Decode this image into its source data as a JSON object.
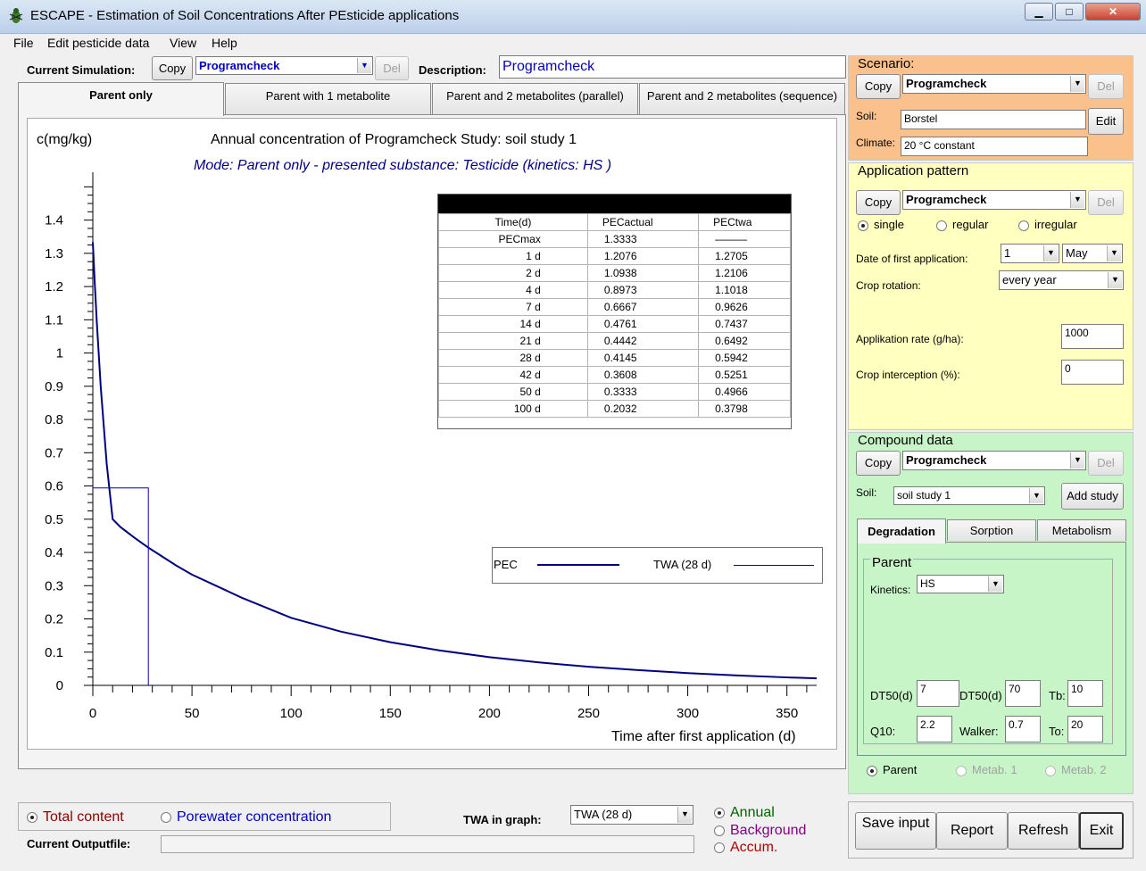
{
  "window": {
    "title": "ESCAPE - Estimation of Soil Concentrations After PEsticide applications",
    "app_icon": "bug-icon"
  },
  "menu": [
    "File",
    "Edit pesticide data",
    "View",
    "Help"
  ],
  "simulation": {
    "label": "Current  Simulation:",
    "copy": "Copy",
    "value": "Programcheck",
    "del": "Del",
    "desc_label": "Description:",
    "desc_value": "Programcheck"
  },
  "tabs": [
    "Parent only",
    "Parent with 1 metabolite",
    "Parent and 2 metabolites (parallel)",
    "Parent and 2 metabolites (sequence)"
  ],
  "chart_data": {
    "type": "line",
    "title": "Annual concentration of Programcheck Study: soil study 1",
    "subtitle": "Mode: Parent only  - presented substance: Testicide (kinetics: HS )",
    "ylabel": "c(mg/kg)",
    "xlabel": "Time after first application (d)",
    "xlim": [
      0,
      365
    ],
    "ylim": [
      0,
      1.45
    ],
    "xticks": [
      "0",
      "50",
      "100",
      "150",
      "200",
      "250",
      "300",
      "350"
    ],
    "yticks": [
      "0",
      "0.1",
      "0.2",
      "0.3",
      "0.4",
      "0.5",
      "0.6",
      "0.7",
      "0.8",
      "0.9",
      "1",
      "1.1",
      "1.2",
      "1.3",
      "1.4"
    ],
    "series": [
      {
        "name": "PEC",
        "color": "#00007f",
        "x": [
          0,
          1,
          2,
          4,
          7,
          10,
          14,
          21,
          28,
          42,
          50,
          75,
          100,
          125,
          150,
          175,
          200,
          225,
          250,
          275,
          300,
          325,
          350,
          365
        ],
        "y": [
          1.3333,
          1.2076,
          1.0938,
          0.8973,
          0.6667,
          0.5,
          0.4761,
          0.4442,
          0.4145,
          0.3608,
          0.3333,
          0.264,
          0.2032,
          0.162,
          0.13,
          0.105,
          0.085,
          0.069,
          0.056,
          0.046,
          0.037,
          0.03,
          0.024,
          0.021
        ]
      },
      {
        "name": "TWA  (28 d)",
        "color": "#0000c0",
        "x": [
          0,
          28,
          28
        ],
        "y": [
          0.5942,
          0.5942,
          0
        ]
      }
    ]
  },
  "pec_table": {
    "headers": [
      "Time(d)",
      "PECactual",
      "PECtwa"
    ],
    "rows": [
      [
        "PECmax",
        "1.3333",
        "———"
      ],
      [
        "1 d",
        "1.2076",
        "1.2705"
      ],
      [
        "2 d",
        "1.0938",
        "1.2106"
      ],
      [
        "4 d",
        "0.8973",
        "1.1018"
      ],
      [
        "7 d",
        "0.6667",
        "0.9626"
      ],
      [
        "14 d",
        "0.4761",
        "0.7437"
      ],
      [
        "21 d",
        "0.4442",
        "0.6492"
      ],
      [
        "28 d",
        "0.4145",
        "0.5942"
      ],
      [
        "42 d",
        "0.3608",
        "0.5251"
      ],
      [
        "50 d",
        "0.3333",
        "0.4966"
      ],
      [
        "100 d",
        "0.2032",
        "0.3798"
      ]
    ]
  },
  "scenario": {
    "title": "Scenario:",
    "copy": "Copy",
    "value": "Programcheck",
    "del": "Del",
    "soil_label": "Soil:",
    "soil": "Borstel",
    "edit": "Edit",
    "climate_label": "Climate:",
    "climate": "20 °C constant",
    "color": "#fbc18c"
  },
  "application": {
    "title": "Application pattern",
    "copy": "Copy",
    "value": "Programcheck",
    "del": "Del",
    "radios": [
      "single",
      "regular",
      "irregular"
    ],
    "selected": "single",
    "date_label": "Date of first application:",
    "day": "1",
    "month": "May",
    "rotation_label": "Crop rotation:",
    "rotation": "every year",
    "rate_label": "Applikation rate (g/ha):",
    "rate": "1000",
    "intercept_label": "Crop interception (%):",
    "intercept": "0",
    "color": "#ffffc0"
  },
  "compound": {
    "title": "Compound data",
    "copy": "Copy",
    "value": "Programcheck",
    "del": "Del",
    "soil_label": "Soil:",
    "soil": "soil study 1",
    "add_study": "Add study",
    "tabs": [
      "Degradation",
      "Sorption",
      "Metabolism"
    ],
    "parent_title": "Parent",
    "kinetics_label": "Kinetics:",
    "kinetics": "HS",
    "dt50a_label": "DT50(d)",
    "dt50a": "7",
    "dt50b_label": "DT50(d)",
    "dt50b": "70",
    "tb_label": "Tb:",
    "tb": "10",
    "q10_label": "Q10:",
    "q10": "2.2",
    "walker_label": "Walker:",
    "walker": "0.7",
    "to_label": "To:",
    "to": "20",
    "radios": [
      "Parent",
      "Metab. 1",
      "Metab. 2"
    ],
    "color": "#c8f5c8"
  },
  "bottom": {
    "total": "Total content",
    "porewater": "Porewater concentration",
    "twa_label": "TWA in graph:",
    "twa": "TWA (28 d)",
    "annual": "Annual",
    "background": "Background",
    "accum": "Accum.",
    "outfile_label": "Current Outputfile:"
  },
  "actions": {
    "save": "Save input",
    "report": "Report",
    "refresh": "Refresh",
    "exit": "Exit"
  }
}
